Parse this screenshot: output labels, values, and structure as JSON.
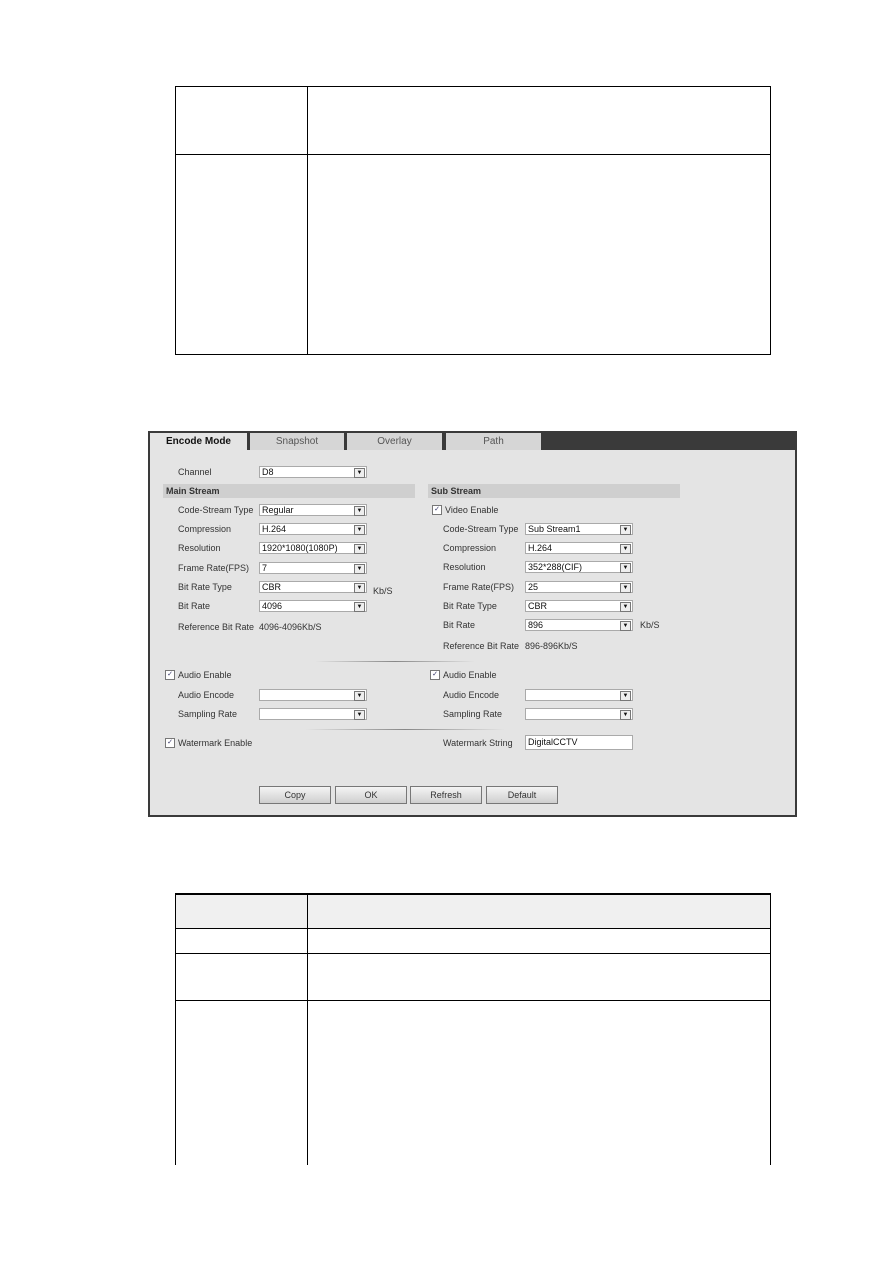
{
  "tabs": [
    "Encode Mode",
    "Snapshot",
    "Overlay",
    "Path"
  ],
  "channel": {
    "label": "Channel",
    "value": "D8"
  },
  "main": {
    "title": "Main Stream",
    "rows": [
      {
        "label": "Code-Stream Type",
        "value": "Regular"
      },
      {
        "label": "Compression",
        "value": "H.264"
      },
      {
        "label": "Resolution",
        "value": "1920*1080(1080P)"
      },
      {
        "label": "Frame Rate(FPS)",
        "value": "7"
      },
      {
        "label": "Bit Rate Type",
        "value": "CBR"
      },
      {
        "label": "Bit Rate",
        "value": "4096"
      }
    ],
    "unit": "Kb/S",
    "ref_label": "Reference Bit Rate",
    "ref_value": "4096-4096Kb/S",
    "audio_enable": "Audio Enable",
    "audio_encode": "Audio Encode",
    "sampling_rate": "Sampling Rate",
    "watermark_enable": "Watermark Enable"
  },
  "sub": {
    "title": "Sub Stream",
    "video_enable": "Video Enable",
    "rows": [
      {
        "label": "Code-Stream Type",
        "value": "Sub Stream1"
      },
      {
        "label": "Compression",
        "value": "H.264"
      },
      {
        "label": "Resolution",
        "value": "352*288(CIF)"
      },
      {
        "label": "Frame Rate(FPS)",
        "value": "25"
      },
      {
        "label": "Bit Rate Type",
        "value": "CBR"
      },
      {
        "label": "Bit Rate",
        "value": "896"
      }
    ],
    "unit": "Kb/S",
    "ref_label": "Reference Bit Rate",
    "ref_value": "896-896Kb/S",
    "audio_enable": "Audio Enable",
    "audio_encode": "Audio Encode",
    "sampling_rate": "Sampling Rate",
    "watermark_label": "Watermark String",
    "watermark_value": "DigitalCCTV"
  },
  "buttons": [
    "Copy",
    "OK",
    "Refresh",
    "Default"
  ],
  "check_mark": "✓"
}
